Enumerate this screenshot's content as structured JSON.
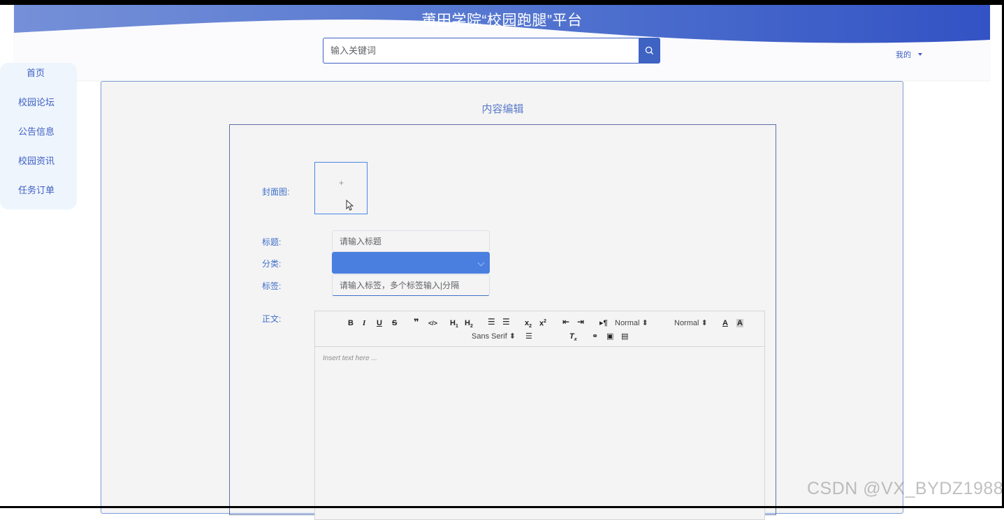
{
  "header": {
    "site_title": "莆田学院“校园跑腿”平台",
    "search_placeholder": "输入关键词",
    "user_menu_label": "我的"
  },
  "sidebar": {
    "items": [
      {
        "label": "首页"
      },
      {
        "label": "校园论坛"
      },
      {
        "label": "公告信息"
      },
      {
        "label": "校园资讯"
      },
      {
        "label": "任务订单"
      }
    ]
  },
  "content": {
    "title": "内容编辑",
    "form": {
      "cover_label": "封面图:",
      "upload_plus": "+",
      "title_label": "标题:",
      "title_placeholder": "请输入标题",
      "category_label": "分类:",
      "category_value": "",
      "tags_label": "标签:",
      "tags_placeholder": "请输入标签，多个标签输入|分隔",
      "body_label": "正文:",
      "editor": {
        "header_select_value": "Normal",
        "size_select_value": "Normal",
        "font_select_value": "Sans Serif",
        "placeholder": "Insert text here ..."
      }
    }
  },
  "watermark": "CSDN @VX_BYDZ1988",
  "colors": {
    "accent": "#3f63c3",
    "banner_start": "#6f8fd8",
    "banner_end": "#3352c4",
    "selected_field": "#4a7fe0"
  }
}
